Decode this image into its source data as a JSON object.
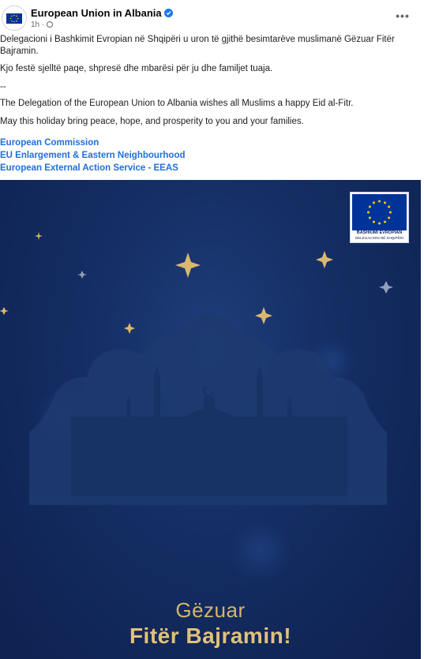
{
  "post": {
    "page_name": "European Union in Albania",
    "time": "1h",
    "paragraphs": [
      "Delegacioni i Bashkimit Evropian në Shqipëri u uron të gjithë besimtarëve muslimanë Gëzuar Fitër Bajramin.",
      "Kjo festë sjelltë paqe, shpresë dhe mbarësi për ju dhe familjet tuaja.",
      "--",
      "The Delegation of the European Union to Albania wishes all Muslims a happy Eid al-Fitr.",
      "May this holiday bring peace, hope, and prosperity to you and your families."
    ],
    "links": [
      "European Commission",
      "EU Enlargement & Eastern Neighbourhood",
      "European External Action Service - EEAS"
    ]
  },
  "image": {
    "logo_line1": "BASHKIMI EVROPIAN",
    "logo_line2": "DELEGACIONI NË SHQIPËRI",
    "greeting_line1": "Gëzuar",
    "greeting_line2": "Fitër Bajramin!"
  },
  "colors": {
    "link": "#216fdb",
    "verified": "#1877f2",
    "background_dark": "#0e2150",
    "gold": "#d6b56a"
  },
  "icons": [
    "verified-badge-icon",
    "globe-icon",
    "more-options-icon",
    "eu-flag-icon",
    "star-icon",
    "mosque-silhouette"
  ]
}
